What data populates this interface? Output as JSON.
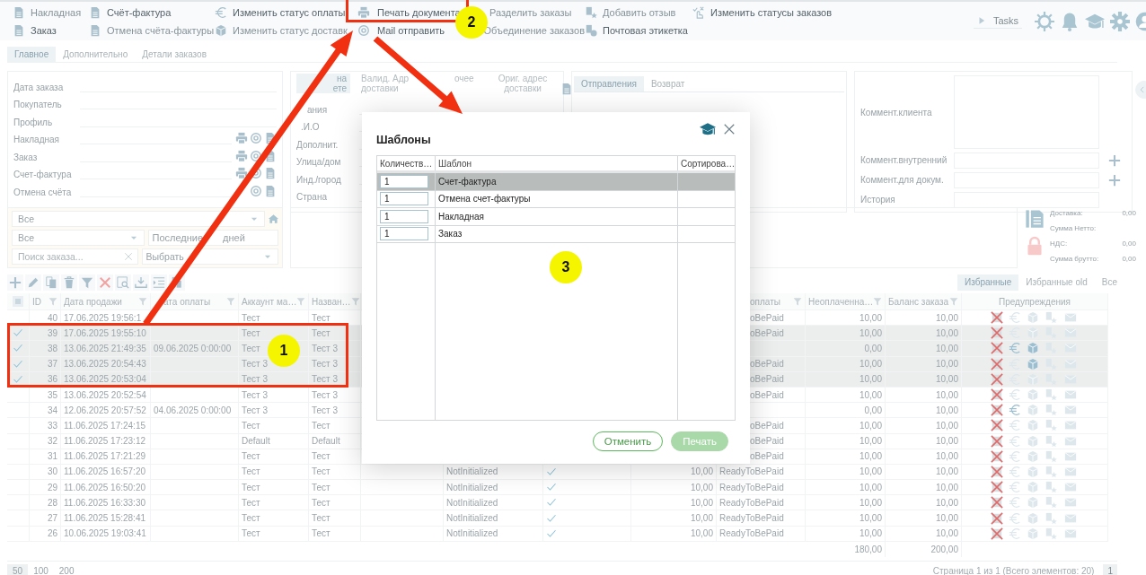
{
  "toolbar": {
    "actions": [
      {
        "label": "Накладная",
        "disabled": true
      },
      {
        "label": "Счёт-фактура",
        "disabled": false
      },
      {
        "label": "Изменить статус оплаты",
        "disabled": false
      },
      {
        "label": "Печать документа",
        "disabled": false
      },
      {
        "label": "Разделить заказы",
        "disabled": true
      },
      {
        "label": "Добавить отзыв",
        "disabled": true
      },
      {
        "label": "Изменить статусы заказов",
        "disabled": false
      },
      {
        "label": "Заказ",
        "disabled": false
      },
      {
        "label": "Отмена счёта-фактуры",
        "disabled": true
      },
      {
        "label": "Изменить статус доставк",
        "disabled": true
      },
      {
        "label": "Mail отправить",
        "disabled": false
      },
      {
        "label": "Объединение заказов",
        "disabled": true
      },
      {
        "label": "Почтовая этикетка",
        "disabled": false
      }
    ],
    "tasks": "Tasks"
  },
  "tabs": [
    {
      "label": "Главное",
      "selected": true
    },
    {
      "label": "Дополнительно",
      "selected": false
    },
    {
      "label": "Детали заказов",
      "selected": false
    }
  ],
  "order_form": [
    {
      "label": "Дата заказа",
      "kind": "plain"
    },
    {
      "label": "Покупатель",
      "kind": "plain"
    },
    {
      "label": "Профиль",
      "kind": "plain"
    },
    {
      "label": "Накладная",
      "kind": "document"
    },
    {
      "label": "Заказ",
      "kind": "document"
    },
    {
      "label": "Счет-фактура",
      "kind": "document"
    },
    {
      "label": "Отмена счёта",
      "kind": "document"
    }
  ],
  "address": {
    "tabs": [
      {
        "label": "на\nете",
        "selected": true
      },
      {
        "label": "Валид. Адр\nдоставки",
        "selected": false
      },
      {
        "label": "очее",
        "selected": false
      },
      {
        "label": "Ориг. адрес\nдоставки",
        "selected": false
      }
    ],
    "fields": [
      "ания",
      ".И.О",
      "Дополнит.",
      "Улица/дом",
      "Инд./город",
      "Страна"
    ]
  },
  "shipping_tabs": [
    {
      "label": "Отправления",
      "selected": true
    },
    {
      "label": "Возврат",
      "selected": false
    }
  ],
  "comments": [
    {
      "label": "Коммент.клиента",
      "kind": "area"
    },
    {
      "label": "Коммент.внутренний",
      "kind": "add"
    },
    {
      "label": "Коммент.для докум.",
      "kind": "add"
    },
    {
      "label": "История",
      "kind": "plain"
    }
  ],
  "filters": {
    "scope": "Все",
    "status": "Все",
    "period_parts": [
      "Последние",
      "дней"
    ],
    "search_placeholder": "Поиск заказа...",
    "choose": "Выбрать"
  },
  "summary": [
    {
      "label": "Доставка:",
      "value": "0,00"
    },
    {
      "label": "Сумма Нетто:"
    },
    {
      "label": "НДС:",
      "value": "0,00"
    },
    {
      "label": "Сумма брутто:",
      "value": "0,00"
    }
  ],
  "views": [
    {
      "label": "Избранные",
      "selected": true
    },
    {
      "label": "Избранные old",
      "selected": false
    },
    {
      "label": "Все",
      "selected": false
    }
  ],
  "table": {
    "select_all": {
      "checked": false,
      "partial": true
    },
    "columns": [
      "ID",
      "Дата продажи",
      "ата оплаты",
      "Аккаунт ма…",
      "Назван…",
      "оплаты",
      "Неоплаченна…",
      "Баланс заказа",
      "Предупреждения"
    ],
    "rows": [
      {
        "id": "40",
        "sale_date": "17.06.2025 19:56:1",
        "account": "Тест",
        "name": "Тест",
        "pay_status": "oBePaid",
        "unpaid": "10,00",
        "balance": "10,00",
        "selected": false,
        "payment_warning": false,
        "delivery_warning": false
      },
      {
        "id": "39",
        "sale_date": "17.06.2025 19:55:10",
        "account": "Тест",
        "name": "Тест",
        "pay_status": "oBePaid",
        "unpaid": "10,00",
        "balance": "10,00",
        "selected": true,
        "payment_warning": false,
        "delivery_warning": false
      },
      {
        "id": "38",
        "sale_date": "13.06.2025 21:49:35",
        "pay_date": "09.06.2025 0:00:00",
        "account": "Тест",
        "name": "Тест 3",
        "unpaid": "0,00",
        "balance": "10,00",
        "selected": true,
        "payment_warning": true,
        "delivery_warning": true
      },
      {
        "id": "37",
        "sale_date": "13.06.2025 20:54:43",
        "account": "Тест 3",
        "name": "Тест 3",
        "pay_status": "oBePaid",
        "unpaid": "10,00",
        "balance": "10,00",
        "selected": true,
        "payment_warning": false,
        "delivery_warning": true
      },
      {
        "id": "36",
        "sale_date": "13.06.2025 20:53:04",
        "account": "Тест 3",
        "name": "Тест 3",
        "pay_status": "oBePaid",
        "unpaid": "10,00",
        "balance": "10,00",
        "selected": true,
        "payment_warning": false,
        "delivery_warning": false
      },
      {
        "id": "35",
        "sale_date": "13.06.2025 20:52:54",
        "account": "Тест 3",
        "name": "Тест 3",
        "pay_status": "oBePaid",
        "unpaid": "10,00",
        "balance": "10,00",
        "selected": false,
        "payment_warning": false,
        "delivery_warning": false
      },
      {
        "id": "34",
        "sale_date": "12.06.2025 20:57:52",
        "pay_date": "04.06.2025 0:00:00",
        "account": "Тест 3",
        "name": "Тест 3",
        "unpaid": "0,00",
        "balance": "10,00",
        "selected": false,
        "payment_warning": true,
        "delivery_warning": false
      },
      {
        "id": "33",
        "sale_date": "11.06.2025 17:24:15",
        "account": "Тест",
        "name": "Тест",
        "pay_status": "oBePaid",
        "unpaid": "10,00",
        "balance": "10,00",
        "selected": false,
        "payment_warning": false,
        "delivery_warning": false
      },
      {
        "id": "32",
        "sale_date": "11.06.2025 17:23:12",
        "account": "Default",
        "name": "Default",
        "pay_status": "oBePaid",
        "unpaid": "10,00",
        "balance": "10,00",
        "selected": false,
        "payment_warning": false,
        "delivery_warning": false
      },
      {
        "id": "31",
        "sale_date": "11.06.2025 17:21:29",
        "account": "Тест",
        "name": "Тест",
        "pay_status": "oBePaid",
        "unpaid": "10,00",
        "balance": "10,00",
        "selected": false,
        "payment_warning": false,
        "delivery_warning": false
      },
      {
        "id": "30",
        "sale_date": "11.06.2025 16:57:20",
        "account": "Тест",
        "name": "Тест",
        "state": "NotInitialized",
        "flag": true,
        "amount": "10,00",
        "pay_status": "ReadyToBePaid",
        "unpaid": "10,00",
        "balance": "10,00",
        "selected": false,
        "payment_warning": false,
        "delivery_warning": false
      },
      {
        "id": "29",
        "sale_date": "11.06.2025 16:50:20",
        "account": "Тест",
        "name": "Тест",
        "state": "NotInitialized",
        "flag": true,
        "amount": "10,00",
        "pay_status": "ReadyToBePaid",
        "unpaid": "10,00",
        "balance": "10,00",
        "selected": false,
        "payment_warning": false,
        "delivery_warning": false
      },
      {
        "id": "28",
        "sale_date": "11.06.2025 16:33:30",
        "account": "Тест",
        "name": "Тест",
        "state": "NotInitialized",
        "flag": true,
        "amount": "10,00",
        "pay_status": "ReadyToBePaid",
        "unpaid": "10,00",
        "balance": "10,00",
        "selected": false,
        "payment_warning": false,
        "delivery_warning": false
      },
      {
        "id": "27",
        "sale_date": "11.06.2025 15:28:41",
        "account": "Тест",
        "name": "Тест",
        "state": "NotInitialized",
        "flag": true,
        "amount": "10,00",
        "pay_status": "ReadyToBePaid",
        "unpaid": "10,00",
        "balance": "10,00",
        "selected": false,
        "payment_warning": false,
        "delivery_warning": false
      },
      {
        "id": "26",
        "sale_date": "10.06.2025 19:03:41",
        "account": "Тест",
        "name": "Тест",
        "state": "NotInitialized",
        "flag": true,
        "amount": "10,00",
        "pay_status": "ReadyToBePaid",
        "unpaid": "10,00",
        "balance": "10,00",
        "selected": false,
        "payment_warning": false,
        "delivery_warning": false
      }
    ],
    "totals": {
      "unpaid": "180,00",
      "balance": "200,00"
    }
  },
  "pager": {
    "sizes": [
      {
        "label": "50",
        "selected": true
      },
      {
        "label": "100",
        "selected": false
      },
      {
        "label": "200",
        "selected": false
      }
    ],
    "info": "Страница 1 из 1 (Всего элементов: 20)",
    "page": "1"
  },
  "dialog": {
    "title": "Шаблоны",
    "columns": [
      "Количеств…",
      "Шаблон",
      "Сортирова…"
    ],
    "rows": [
      {
        "quantity": "1",
        "name": "Счет-фактура",
        "selected": true
      },
      {
        "quantity": "1",
        "name": "Отмена счет-фактуры",
        "selected": false
      },
      {
        "quantity": "1",
        "name": "Накладная",
        "selected": false
      },
      {
        "quantity": "1",
        "name": "Заказ",
        "selected": false
      }
    ],
    "cancel": "Отменить",
    "print": "Печать"
  },
  "annotations": [
    {
      "label": "1"
    },
    {
      "label": "2"
    },
    {
      "label": "3"
    }
  ]
}
